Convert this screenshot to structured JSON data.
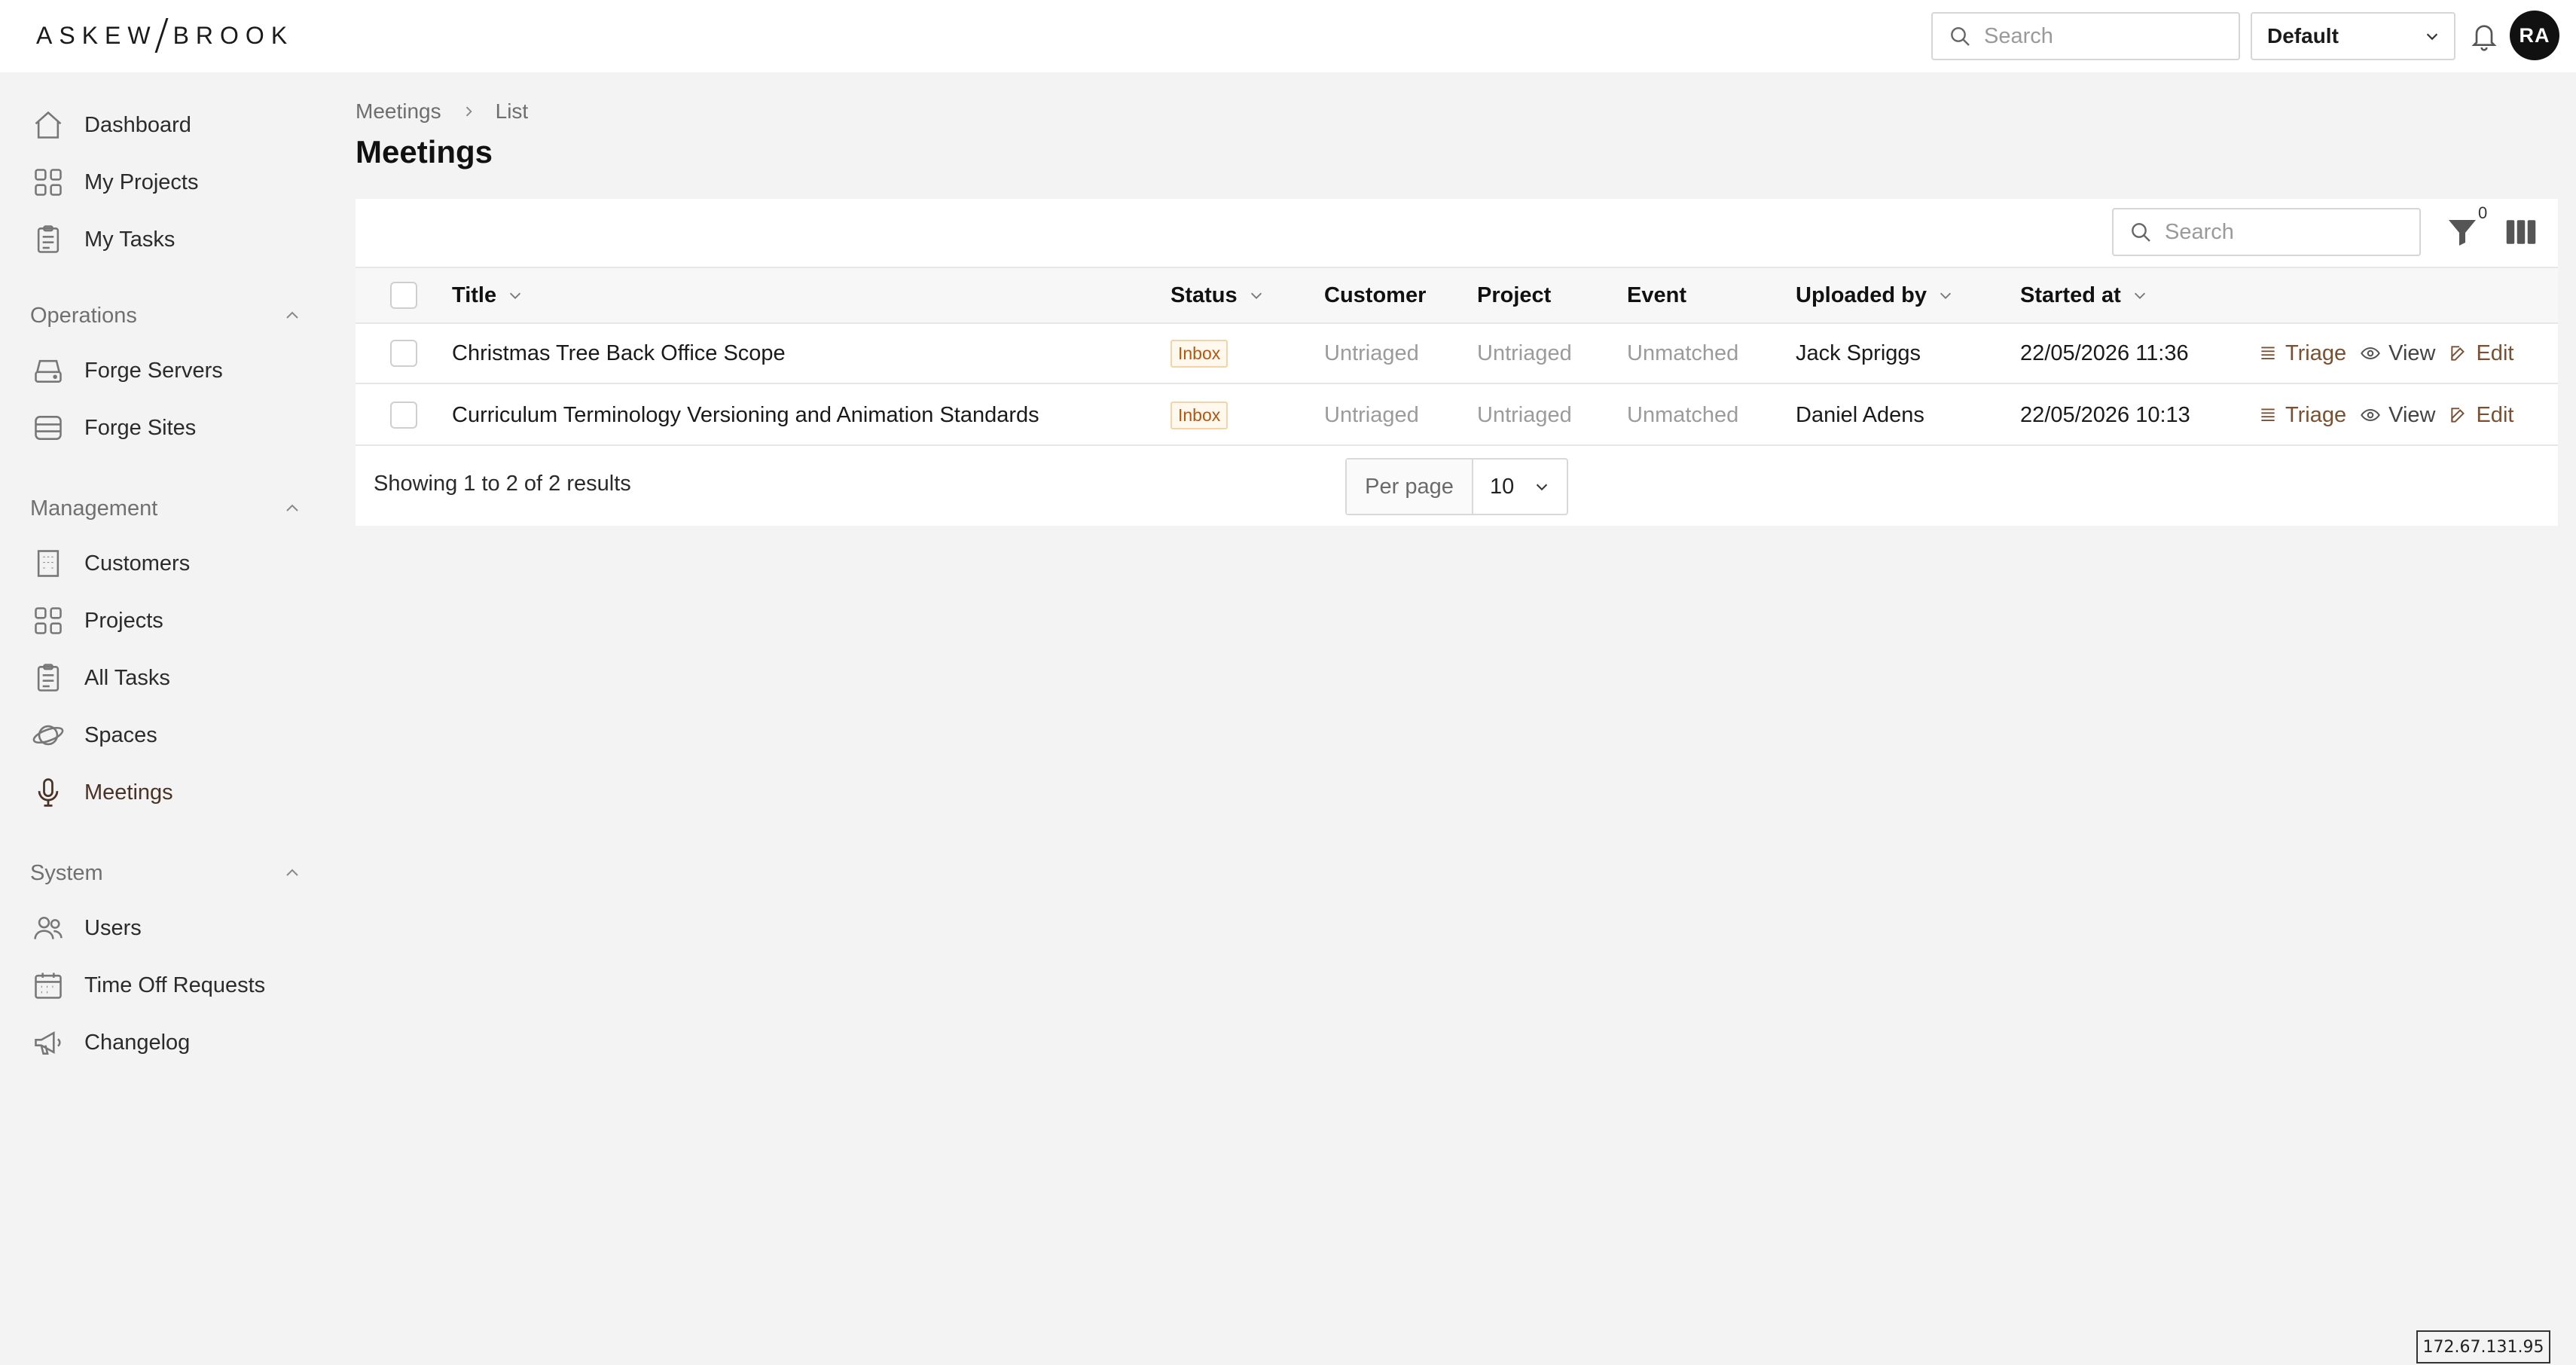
{
  "brand": {
    "left": "ASKEW",
    "right": "BROOK"
  },
  "header": {
    "search_placeholder": "Search",
    "workspace_select": "Default",
    "avatar_initials": "RA"
  },
  "sidebar": {
    "top_items": [
      {
        "label": "Dashboard",
        "icon": "home-icon"
      },
      {
        "label": "My Projects",
        "icon": "grid-icon"
      },
      {
        "label": "My Tasks",
        "icon": "clipboard-icon"
      }
    ],
    "sections": [
      {
        "title": "Operations",
        "items": [
          {
            "label": "Forge Servers",
            "icon": "server-icon"
          },
          {
            "label": "Forge Sites",
            "icon": "database-icon"
          }
        ]
      },
      {
        "title": "Management",
        "items": [
          {
            "label": "Customers",
            "icon": "building-icon"
          },
          {
            "label": "Projects",
            "icon": "grid-icon"
          },
          {
            "label": "All Tasks",
            "icon": "clipboard-icon"
          },
          {
            "label": "Spaces",
            "icon": "planet-icon"
          },
          {
            "label": "Meetings",
            "icon": "microphone-icon",
            "active": true
          }
        ]
      },
      {
        "title": "System",
        "items": [
          {
            "label": "Users",
            "icon": "users-icon"
          },
          {
            "label": "Time Off Requests",
            "icon": "calendar-icon"
          },
          {
            "label": "Changelog",
            "icon": "megaphone-icon"
          }
        ]
      }
    ]
  },
  "breadcrumb": [
    "Meetings",
    "List"
  ],
  "page_title": "Meetings",
  "table": {
    "search_placeholder": "Search",
    "filter_count": "0",
    "columns": [
      "Title",
      "Status",
      "Customer",
      "Project",
      "Event",
      "Uploaded by",
      "Started at"
    ],
    "rows": [
      {
        "title": "Christmas Tree Back Office Scope",
        "status": "Inbox",
        "customer": "Untriaged",
        "project": "Untriaged",
        "event": "Unmatched",
        "uploaded_by": "Jack Spriggs",
        "started_at": "22/05/2026 11:36"
      },
      {
        "title": "Curriculum Terminology Versioning and Animation Standards",
        "status": "Inbox",
        "customer": "Untriaged",
        "project": "Untriaged",
        "event": "Unmatched",
        "uploaded_by": "Daniel Adens",
        "started_at": "22/05/2026 10:13"
      }
    ],
    "actions": [
      "Triage",
      "View",
      "Edit"
    ],
    "footer": "Showing 1 to 2 of 2 results",
    "per_page_label": "Per page",
    "per_page_value": "10"
  },
  "ip_address": "172.67.131.95",
  "colors": {
    "accent": "#7a4f32",
    "badge_text": "#b4560b",
    "badge_border": "#f3d3a8"
  }
}
